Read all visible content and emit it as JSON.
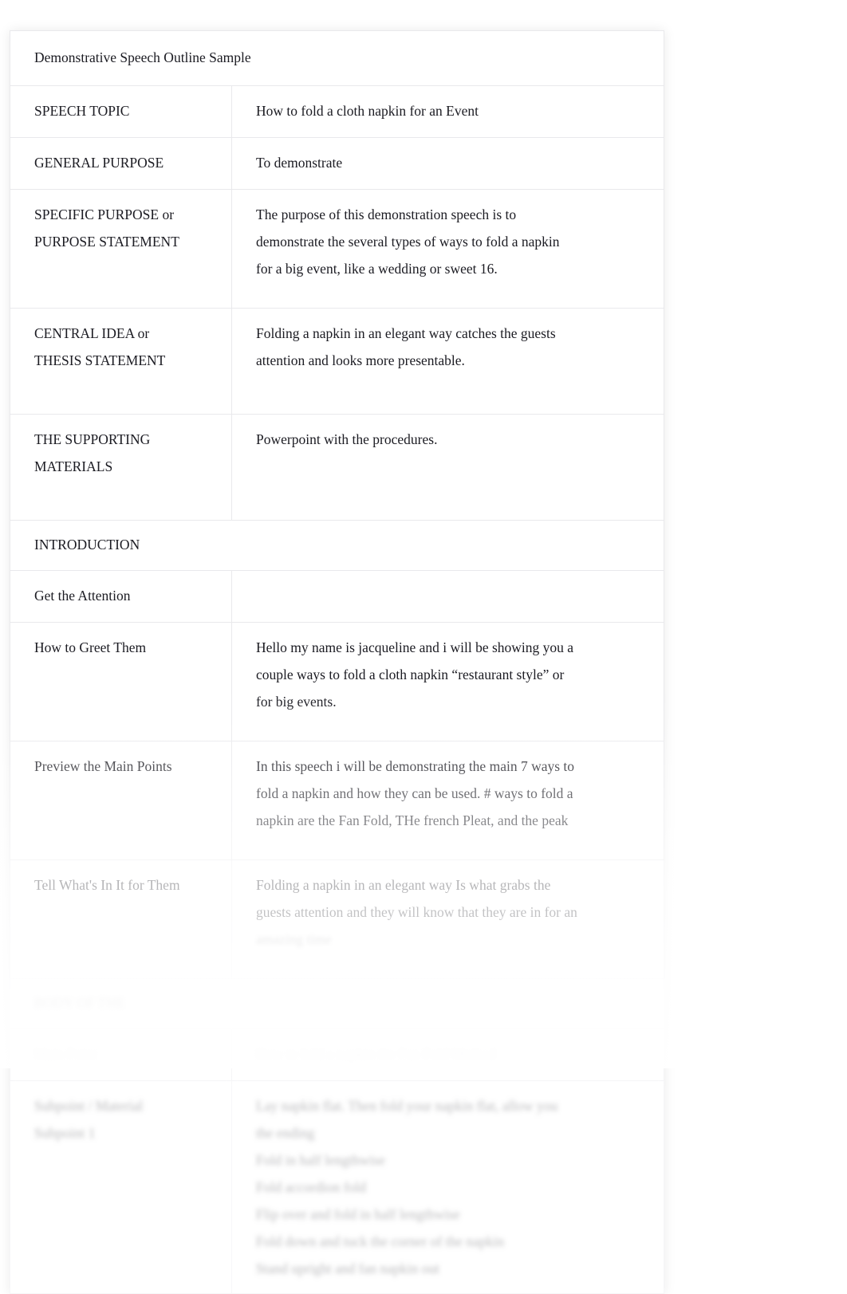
{
  "document": {
    "title": "Demonstrative Speech Outline Sample"
  },
  "table": {
    "rows": [
      {
        "label": "SPEECH TOPIC",
        "value_lines": [
          "How to fold a cloth napkin for an Event"
        ]
      },
      {
        "label": "GENERAL PURPOSE",
        "value_lines": [
          "To demonstrate"
        ]
      },
      {
        "label_lines": [
          "SPECIFIC PURPOSE or",
          "PURPOSE STATEMENT"
        ],
        "value_lines": [
          "The purpose of this demonstration speech is to",
          "demonstrate the several types of ways to fold a napkin",
          "for a big event, like a wedding or sweet 16."
        ]
      },
      {
        "label_lines": [
          "CENTRAL IDEA or",
          "THESIS STATEMENT"
        ],
        "value_lines": [
          "Folding a napkin in an elegant way catches the guests",
          "attention and looks more presentable."
        ]
      },
      {
        "label_lines": [
          "THE SUPPORTING",
          "MATERIALS"
        ],
        "value_lines": [
          "Powerpoint with the procedures."
        ]
      }
    ],
    "section_introduction": "INTRODUCTION",
    "intro_rows": [
      {
        "label": "Get the Attention",
        "value_lines": [
          ""
        ]
      },
      {
        "label": "How to Greet Them",
        "value_lines": [
          "Hello my name is jacqueline and i will be showing you a",
          "couple ways to fold a cloth napkin “restaurant style” or",
          "for big events."
        ]
      },
      {
        "label": "Preview the Main Points",
        "value_lines": [
          "In this speech i will be demonstrating the main 7 ways to",
          "fold a napkin and how they can be used. # ways to fold a",
          "napkin are the Fan Fold, THe french Pleat, and the peak"
        ]
      },
      {
        "label": "Tell What's In It for Them",
        "value_lines": [
          "Folding a napkin in an elegant way Is what grabs the",
          "guests attention and they will know that they are in for an",
          "amazing time"
        ]
      }
    ],
    "section_body": "BODY OF THE",
    "faded_rows": [
      {
        "label": "Main Point",
        "value_lines": [
          "How to fold a napkin the Fan Fold Method"
        ]
      },
      {
        "label_lines": [
          "Subpoint / Material",
          "Subpoint 1"
        ],
        "value_lines": [
          "Lay napkin flat. Then fold your napkin flat, allow you",
          "the ending",
          "Fold in half lengthwise",
          "Fold accordion fold",
          "Flip over and fold in half lengthwise",
          "Fold down and tuck the corner of the napkin",
          "Stand upright and fan napkin out"
        ]
      }
    ]
  }
}
